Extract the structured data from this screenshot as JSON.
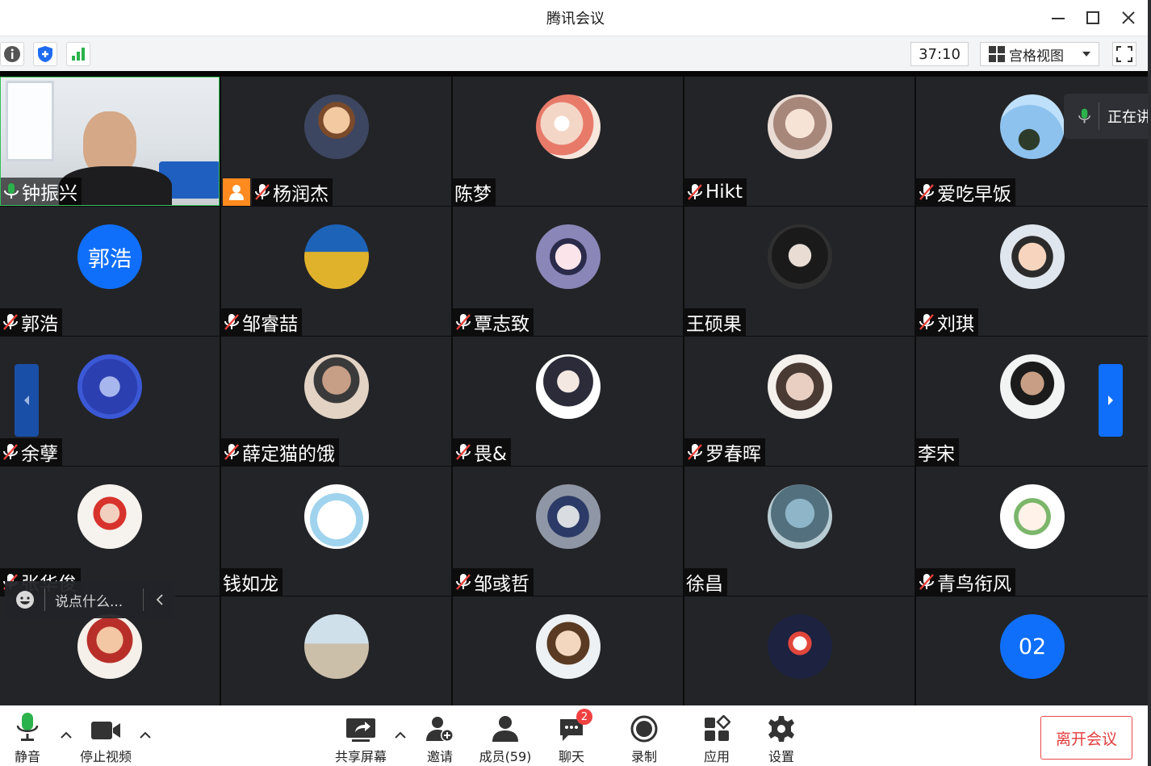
{
  "window": {
    "title": "腾讯会议"
  },
  "toolbar": {
    "timer": "37:10",
    "view_label": "宫格视图"
  },
  "speaking_indicator": "正在讲",
  "chat": {
    "placeholder": "说点什么..."
  },
  "participants": [
    {
      "name": "钟振兴",
      "mic": "on",
      "video": true
    },
    {
      "name": "杨润杰",
      "mic": "muted",
      "host": true
    },
    {
      "name": "陈梦",
      "mic": "none"
    },
    {
      "name": "Hikt",
      "mic": "muted"
    },
    {
      "name": "爱吃早饭",
      "mic": "muted"
    },
    {
      "name": "郭浩",
      "mic": "muted",
      "avatar_text": "郭浩"
    },
    {
      "name": "邹睿喆",
      "mic": "muted"
    },
    {
      "name": "覃志致",
      "mic": "muted"
    },
    {
      "name": "王硕果",
      "mic": "none"
    },
    {
      "name": "刘琪",
      "mic": "muted"
    },
    {
      "name": "余孽",
      "mic": "muted"
    },
    {
      "name": "薛定猫的饿",
      "mic": "muted"
    },
    {
      "name": "畏&",
      "mic": "muted"
    },
    {
      "name": "罗春晖",
      "mic": "muted"
    },
    {
      "name": "李宋",
      "mic": "none"
    },
    {
      "name": "张华俊",
      "mic": "muted"
    },
    {
      "name": "钱如龙",
      "mic": "none"
    },
    {
      "name": "邹彧哲",
      "mic": "muted"
    },
    {
      "name": "徐昌",
      "mic": "none"
    },
    {
      "name": "青鸟衔风",
      "mic": "muted"
    },
    {
      "name": "",
      "mic": "none"
    },
    {
      "name": "",
      "mic": "none"
    },
    {
      "name": "",
      "mic": "none"
    },
    {
      "name": "",
      "mic": "none"
    },
    {
      "name": "",
      "mic": "none",
      "avatar_text": "02"
    }
  ],
  "controls": {
    "mute": "静音",
    "stop_video": "停止视频",
    "share_screen": "共享屏幕",
    "invite": "邀请",
    "members": "成员(59)",
    "chat": "聊天",
    "chat_badge": "2",
    "record": "录制",
    "apps": "应用",
    "settings": "设置",
    "leave": "离开会议"
  },
  "colors": {
    "accent_blue": "#0f6ffb",
    "active_speaker": "#36c05a",
    "leave_red": "#e23c3d",
    "tile_bg": "#232427"
  }
}
